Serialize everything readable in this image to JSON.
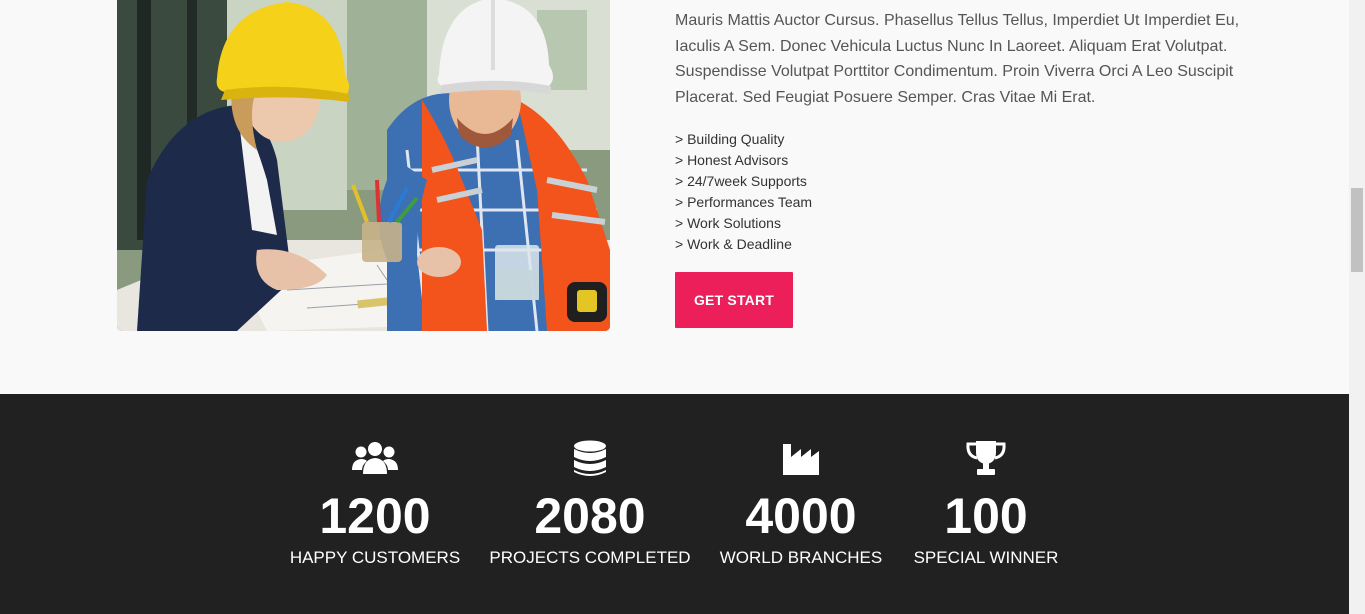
{
  "about": {
    "photo_alt": "Construction engineers reviewing blueprints",
    "intro": "Mauris Mattis Auctor Cursus. Phasellus Tellus Tellus, Imperdiet Ut Imperdiet Eu, Iaculis A Sem. Donec Vehicula Luctus Nunc In Laoreet. Aliquam Erat Volutpat. Suspendisse Volutpat Porttitor Condimentum. Proin Viverra Orci A Leo Suscipit Placerat. Sed Feugiat Posuere Semper. Cras Vitae Mi Erat.",
    "features": [
      "> Building Quality",
      "> Honest Advisors",
      "> 24/7week Supports",
      "> Performances Team",
      "> Work Solutions",
      "> Work & Deadline"
    ],
    "cta_label": "GET START"
  },
  "stats": [
    {
      "icon": "users-icon",
      "value": "1200",
      "label": "HAPPY CUSTOMERS"
    },
    {
      "icon": "database-icon",
      "value": "2080",
      "label": "PROJECTS COMPLETED"
    },
    {
      "icon": "industry-icon",
      "value": "4000",
      "label": "WORLD BRANCHES"
    },
    {
      "icon": "trophy-icon",
      "value": "100",
      "label": "SPECIAL WINNER"
    }
  ],
  "colors": {
    "accent": "#ec1f5a",
    "stats_background": "#212121",
    "page_background": "#f9f9f9"
  }
}
